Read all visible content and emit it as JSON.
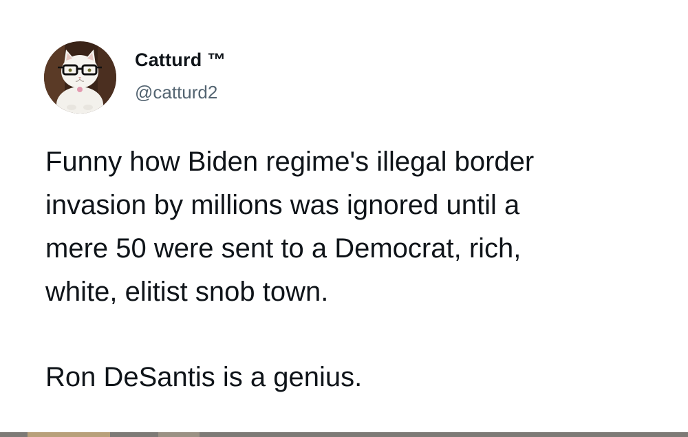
{
  "author": {
    "display_name": "Catturd ™",
    "handle": "@catturd2",
    "avatar_icon": "cat-with-glasses-avatar"
  },
  "tweet": {
    "lines": [
      "Funny how Biden regime's illegal border",
      "invasion by millions was ignored until a",
      "mere 50 were sent to a Democrat, rich,",
      "white, elitist snob town."
    ],
    "closing_line": "Ron DeSantis is a genius."
  },
  "colors": {
    "text_primary": "#0f1419",
    "text_secondary": "#536471",
    "background": "#ffffff"
  }
}
